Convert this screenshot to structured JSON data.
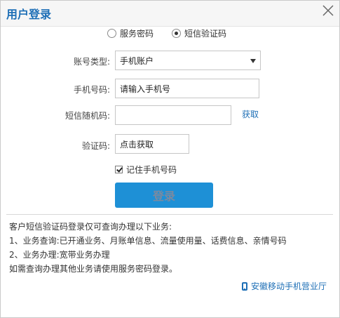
{
  "dialog": {
    "title": "用户登录"
  },
  "login_mode": {
    "options": [
      {
        "label": "服务密码",
        "selected": false
      },
      {
        "label": "短信验证码",
        "selected": true
      }
    ]
  },
  "form": {
    "account_type": {
      "label": "账号类型:",
      "value": "手机账户"
    },
    "phone": {
      "label": "手机号码:",
      "placeholder": "请输入手机号"
    },
    "sms_code": {
      "label": "短信随机码:",
      "value": "",
      "get_label": "获取"
    },
    "captcha": {
      "label": "验证码:",
      "placeholder": "点击获取"
    },
    "remember": {
      "label": "记住手机号码",
      "checked": true
    },
    "submit_label": "登录"
  },
  "notes": {
    "lines": [
      "客户短信验证码登录仅可查询办理以下业务:",
      "1、业务查询:已开通业务、月账单信息、流量使用量、话费信息、亲情号码",
      "2、业务办理:宽带业务办理",
      "如需查询办理其他业务请使用服务密码登录。"
    ]
  },
  "footer": {
    "app_link": "安徽移动手机营业厅"
  },
  "colors": {
    "accent": "#1e6fb6",
    "button": "#1e90d6"
  },
  "icons": {
    "close": "close-icon",
    "phone": "phone-icon"
  }
}
